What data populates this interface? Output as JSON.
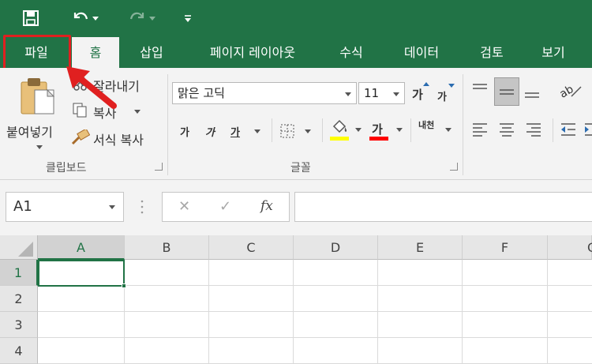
{
  "qat": {
    "save_icon": "save-icon",
    "undo_icon": "undo-icon",
    "redo_icon": "redo-icon",
    "customize_icon": "customize-qat-icon"
  },
  "tabs": [
    {
      "label": "파일",
      "active": false
    },
    {
      "label": "홈",
      "active": true
    },
    {
      "label": "삽입",
      "active": false
    },
    {
      "label": "페이지 레이아웃",
      "active": false
    },
    {
      "label": "수식",
      "active": false
    },
    {
      "label": "데이터",
      "active": false
    },
    {
      "label": "검토",
      "active": false
    },
    {
      "label": "보기",
      "active": false
    }
  ],
  "clipboard": {
    "paste_label": "붙여넣기",
    "cut_label": "잘라내기",
    "copy_label": "복사",
    "format_painter_label": "서식 복사",
    "group_label": "클립보드"
  },
  "font": {
    "font_name": "맑은 고딕",
    "font_size": "11",
    "grow_font_glyph": "가",
    "shrink_font_glyph": "가",
    "bold_glyph": "가",
    "italic_glyph": "가",
    "underline_glyph": "가",
    "font_color_glyph": "가",
    "phonetic_glyph": "내천",
    "group_label": "글꼴"
  },
  "colors": {
    "excel_green": "#217346",
    "highlight_red": "#e02020",
    "fill_yellow": "#ffff00",
    "font_red": "#ff0000"
  },
  "name_box": "A1",
  "formula_buttons": {
    "cancel": "✕",
    "enter": "✓",
    "fx": "fx"
  },
  "columns": [
    "A",
    "B",
    "C",
    "D",
    "E",
    "F",
    "G"
  ],
  "rows": [
    "1",
    "2",
    "3",
    "4"
  ]
}
